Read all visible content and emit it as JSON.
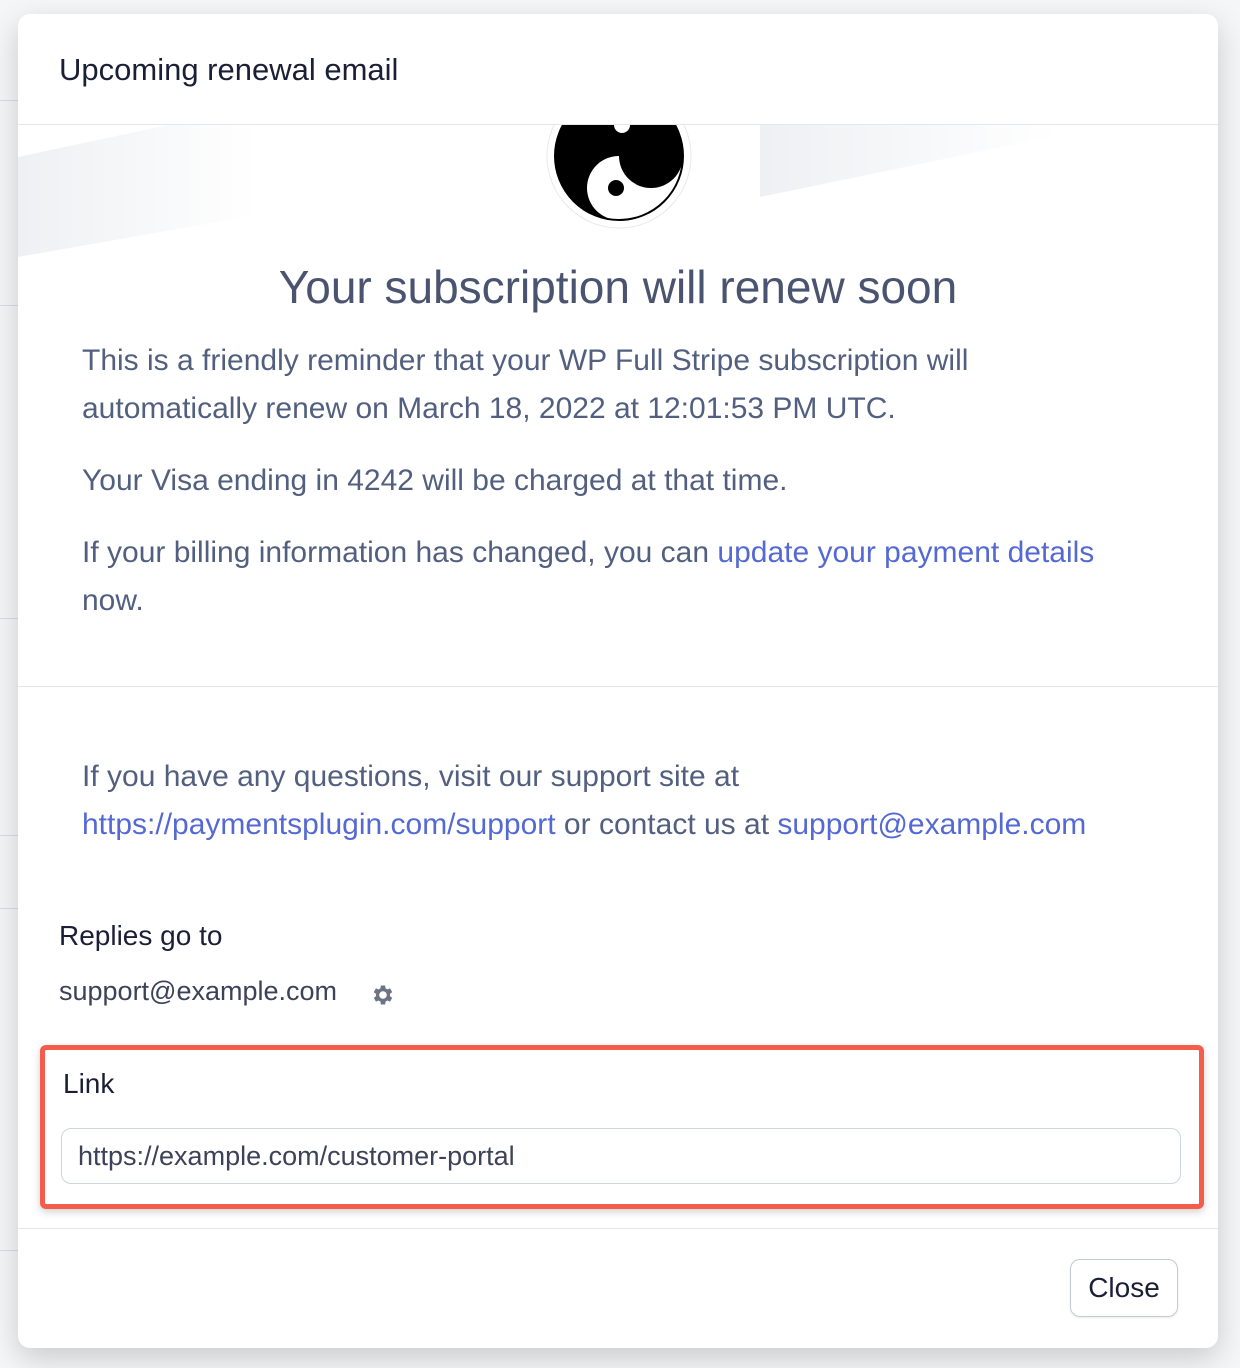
{
  "modal": {
    "title": "Upcoming renewal email",
    "close_label": "Close"
  },
  "preview": {
    "headline": "Your subscription will renew soon",
    "p1": "This is a friendly reminder that your WP Full Stripe subscription will automatically renew on March 18, 2022 at 12:01:53 PM UTC.",
    "p2": "Your Visa ending in 4242 will be charged at that time.",
    "p3_prefix": "If your billing information has changed, you can ",
    "p3_link": "update your payment details",
    "p3_suffix": " now.",
    "p4_prefix": "If you have any questions, visit our support site at ",
    "p4_link": "https://paymentsplugin.com/support",
    "p4_middle": " or contact us at ",
    "p4_email": "support@example.com"
  },
  "replies": {
    "label": "Replies go to",
    "value": "support@example.com",
    "icon": "gear-icon"
  },
  "link_field": {
    "label": "Link",
    "value": "https://example.com/customer-portal"
  },
  "colors": {
    "link": "#5469d4",
    "highlight": "#f45d4c"
  }
}
